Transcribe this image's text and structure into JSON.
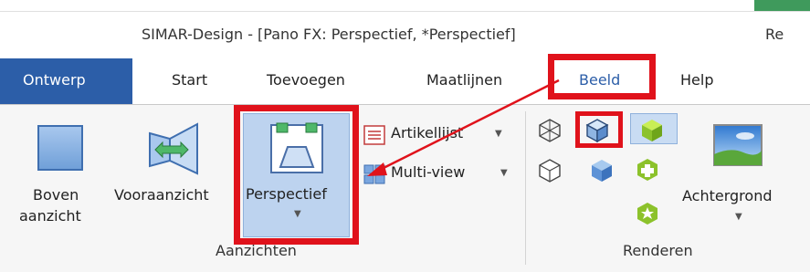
{
  "window": {
    "title": "SIMAR-Design - [Pano FX: Perspectief, *Perspectief]",
    "context_tab_partial": "Re"
  },
  "tabs": [
    {
      "label": "Ontwerp",
      "active": true
    },
    {
      "label": "Start"
    },
    {
      "label": "Toevoegen"
    },
    {
      "label": "Maatlijnen"
    },
    {
      "label": "Beeld",
      "highlighted": true
    },
    {
      "label": "Help"
    }
  ],
  "groups": {
    "aanzichten": {
      "label": "Aanzichten",
      "buttons": {
        "boven_line1": "Boven",
        "boven_line2": "aanzicht",
        "vooraanzicht": "Vooraanzicht",
        "perspectief": "Perspectief"
      },
      "small_buttons": {
        "artikellijst": "Artikellijst",
        "multiview": "Multi-view"
      }
    },
    "renderen": {
      "label": "Renderen",
      "achtergrond": "Achtergrond"
    }
  },
  "colors": {
    "accent_tab": "#2c5ea8",
    "highlight": "#e0121b",
    "context_accent": "#3f9a5c"
  },
  "icons": [
    "boven-icon",
    "vooraanzicht-icon",
    "perspectief-icon",
    "artikellijst-icon",
    "multiview-icon",
    "wireframe-cube-icon",
    "shaded-cube-icon",
    "solid-green-cube-icon",
    "outline-cube-icon",
    "blue-cube-icon",
    "green-plus-icon",
    "green-star-icon",
    "landscape-icon"
  ]
}
